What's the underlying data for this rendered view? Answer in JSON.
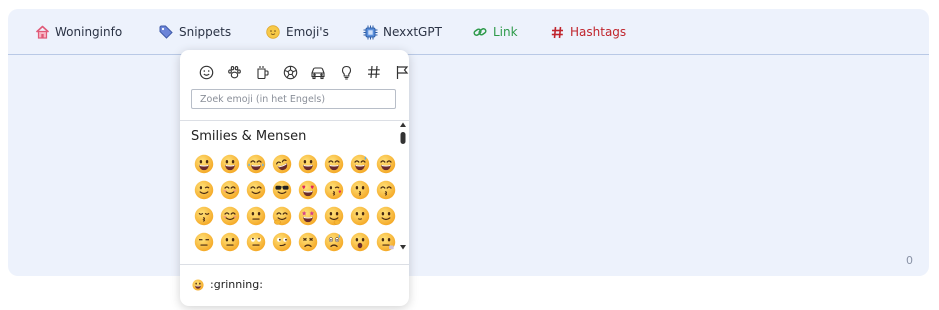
{
  "toolbar": {
    "items": [
      {
        "label": "Woninginfo",
        "icon": "house-icon",
        "color": "#2b3345"
      },
      {
        "label": "Snippets",
        "icon": "tag-icon",
        "color": "#2b3345"
      },
      {
        "label": "Emoji's",
        "icon": "smiley-icon",
        "color": "#2b3345"
      },
      {
        "label": "NexxtGPT",
        "icon": "chip-icon",
        "color": "#2b3345"
      },
      {
        "label": "Link",
        "icon": "link-icon",
        "color": "#2d9a4a"
      },
      {
        "label": "Hashtags",
        "icon": "hash-icon",
        "color": "#c0242c"
      }
    ]
  },
  "editor": {
    "char_count": "0",
    "background": "#edf2fc"
  },
  "emoji_picker": {
    "categories": [
      "smiley-icon",
      "paw-icon",
      "cup-icon",
      "ball-icon",
      "car-icon",
      "bulb-icon",
      "hash-icon",
      "flag-icon"
    ],
    "search_placeholder": "Zoek emoji (in het Engels)",
    "section_title": "Smilies & Mensen",
    "preview_label": ":grinning:"
  }
}
